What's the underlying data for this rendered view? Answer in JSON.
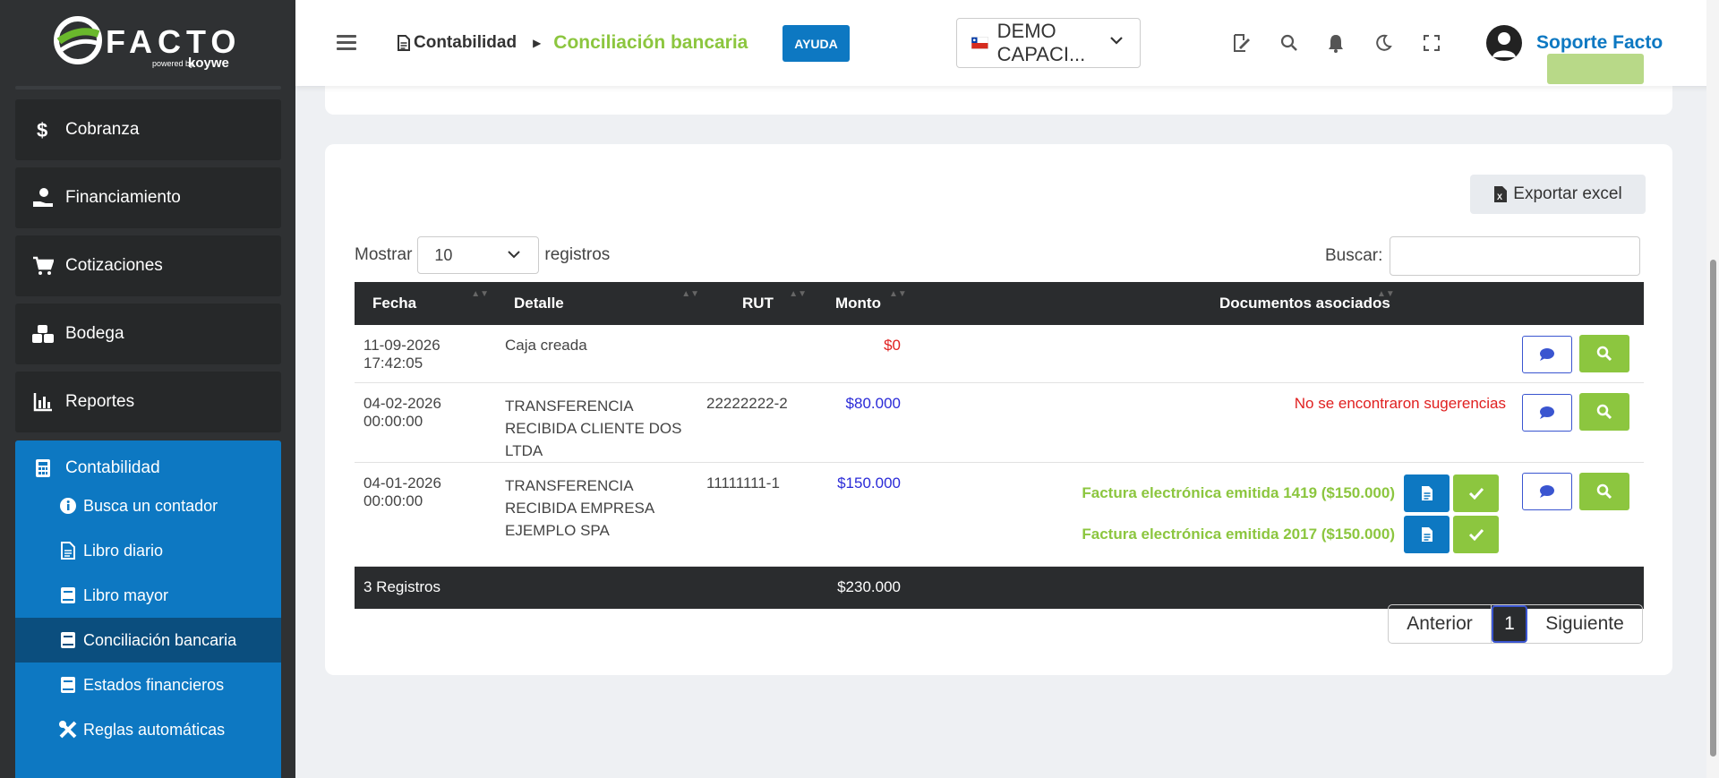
{
  "logo": {
    "name": "FACTO",
    "powered": "powered",
    "by": "by",
    "partner": "koywe"
  },
  "sidebar": {
    "items": [
      {
        "label": "Cobranza",
        "icon": "dollar-icon"
      },
      {
        "label": "Financiamiento",
        "icon": "hand-money-icon"
      },
      {
        "label": "Cotizaciones",
        "icon": "cart-icon"
      },
      {
        "label": "Bodega",
        "icon": "boxes-icon"
      },
      {
        "label": "Reportes",
        "icon": "bar-chart-icon"
      }
    ],
    "group": {
      "label": "Contabilidad",
      "icon": "calculator-icon",
      "subitems": [
        {
          "label": "Busca un contador",
          "icon": "info-icon"
        },
        {
          "label": "Libro diario",
          "icon": "document-icon"
        },
        {
          "label": "Libro mayor",
          "icon": "book-icon"
        },
        {
          "label": "Conciliación bancaria",
          "icon": "book-icon",
          "active": true
        },
        {
          "label": "Estados financieros",
          "icon": "book-icon"
        },
        {
          "label": "Reglas automáticas",
          "icon": "tools-icon"
        }
      ]
    }
  },
  "header": {
    "breadcrumb_section": "Contabilidad",
    "breadcrumb_page": "Conciliación bancaria",
    "help_label": "AYUDA",
    "company": "DEMO CAPACI...",
    "user": "Soporte Facto"
  },
  "toolbar": {
    "export_label": "Exportar excel",
    "show_label": "Mostrar",
    "show_value": "10",
    "records_label": "registros",
    "search_label": "Buscar:"
  },
  "table": {
    "headers": [
      "Fecha",
      "Detalle",
      "RUT",
      "Monto",
      "Documentos asociados"
    ],
    "rows": [
      {
        "fecha": "11-09-2026 17:42:05",
        "detalle": "Caja creada",
        "rut": "",
        "monto": "$0",
        "monto_color": "red"
      },
      {
        "fecha": "04-02-2026 00:00:00",
        "detalle": "TRANSFERENCIA RECIBIDA CLIENTE DOS LTDA",
        "rut": "22222222-2",
        "monto": "$80.000",
        "monto_color": "blue",
        "note": "No se encontraron sugerencias"
      },
      {
        "fecha": "04-01-2026 00:00:00",
        "detalle": "TRANSFERENCIA RECIBIDA EMPRESA EJEMPLO SPA",
        "rut": "11111111-1",
        "monto": "$150.000",
        "monto_color": "blue",
        "docs": [
          "Factura electrónica emitida 1419 ($150.000)",
          "Factura electrónica emitida 2017 ($150.000)"
        ]
      }
    ],
    "footer_count": "3 Registros",
    "footer_total": "$230.000"
  },
  "pagination": {
    "prev": "Anterior",
    "current": "1",
    "next": "Siguiente"
  },
  "colors": {
    "accent_green": "#8cc63f",
    "accent_blue": "#0d78c2",
    "sidebar_bg": "#2f3133",
    "amount_red": "#e02020",
    "amount_blue": "#2a2ad8"
  }
}
